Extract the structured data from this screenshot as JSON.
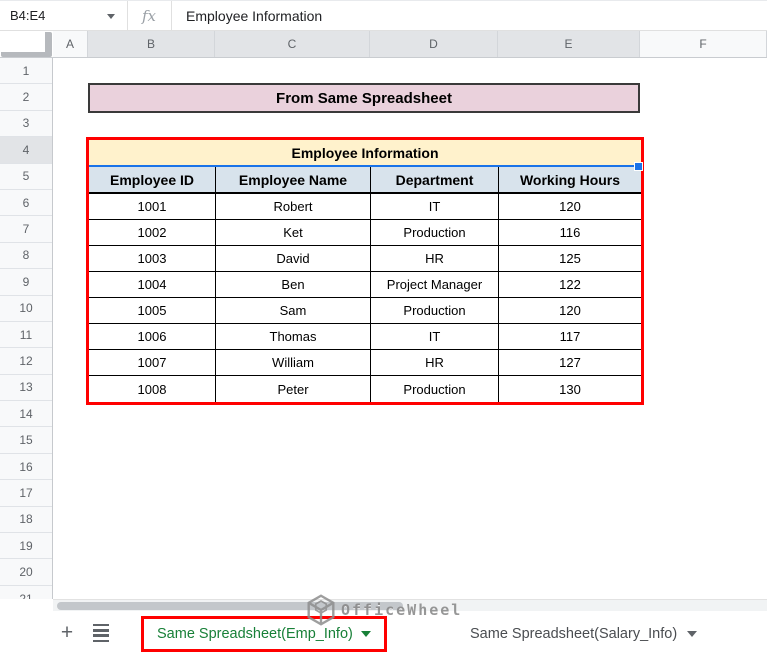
{
  "formula_bar": {
    "name_box_value": "B4:E4",
    "fx_label": "fx",
    "formula_value": "Employee Information"
  },
  "grid": {
    "column_headers": [
      "A",
      "B",
      "C",
      "D",
      "E",
      "F"
    ],
    "selected_columns": [
      "B",
      "C",
      "D",
      "E"
    ],
    "row_count": 21,
    "selected_row": 4
  },
  "banner": {
    "text": "From Same Spreadsheet"
  },
  "employee_table": {
    "title": "Employee Information",
    "headers": [
      "Employee ID",
      "Employee Name",
      "Department",
      "Working Hours"
    ],
    "rows": [
      [
        "1001",
        "Robert",
        "IT",
        "120"
      ],
      [
        "1002",
        "Ket",
        "Production",
        "116"
      ],
      [
        "1003",
        "David",
        "HR",
        "125"
      ],
      [
        "1004",
        "Ben",
        "Project Manager",
        "122"
      ],
      [
        "1005",
        "Sam",
        "Production",
        "120"
      ],
      [
        "1006",
        "Thomas",
        "IT",
        "117"
      ],
      [
        "1007",
        "William",
        "HR",
        "127"
      ],
      [
        "1008",
        "Peter",
        "Production",
        "130"
      ]
    ]
  },
  "sheet_tabs": {
    "add_button": "+",
    "active": {
      "label": "Same Spreadsheet(Emp_Info)"
    },
    "inactive": {
      "label": "Same Spreadsheet(Salary_Info)"
    }
  },
  "watermark": {
    "text": "OfficeWheel"
  },
  "colors": {
    "banner_bg": "#ead1dc",
    "table_title_bg": "#fff2cc",
    "table_header_bg": "#d8e3ec",
    "selection_blue": "#1a73e8",
    "annotation_red": "#ff0000",
    "active_tab_green": "#188038"
  }
}
